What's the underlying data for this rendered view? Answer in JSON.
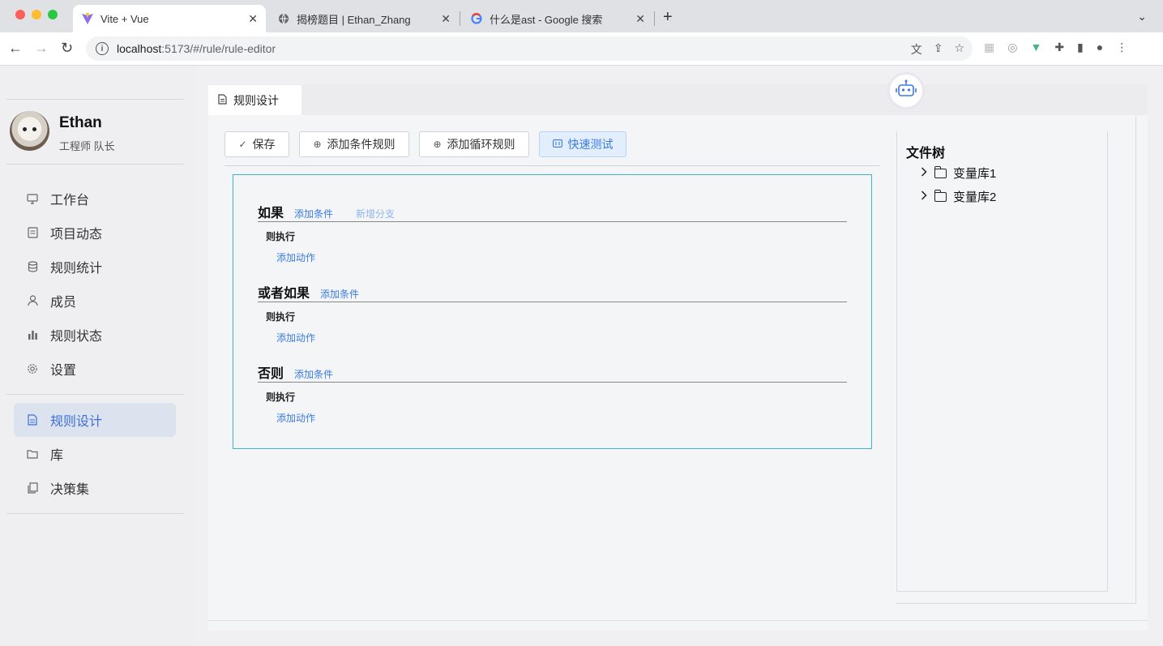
{
  "browser": {
    "tabs": [
      {
        "title": "Vite + Vue",
        "icon": "vite-icon",
        "active": true
      },
      {
        "title": "揭榜题目 | Ethan_Zhang",
        "icon": "globe-icon",
        "active": false
      },
      {
        "title": "什么是ast - Google 搜索",
        "icon": "google-icon",
        "active": false
      }
    ],
    "url_host": "localhost",
    "url_path": ":5173/#/rule/rule-editor"
  },
  "profile": {
    "name": "Ethan",
    "role": "工程师 队长"
  },
  "sidebar": {
    "items": [
      {
        "label": "工作台",
        "icon": "monitor-icon"
      },
      {
        "label": "项目动态",
        "icon": "news-icon"
      },
      {
        "label": "规则统计",
        "icon": "database-icon"
      },
      {
        "label": "成员",
        "icon": "user-icon"
      },
      {
        "label": "规则状态",
        "icon": "bar-chart-icon"
      },
      {
        "label": "设置",
        "icon": "gear-icon"
      }
    ],
    "items2": [
      {
        "label": "规则设计",
        "icon": "document-icon",
        "active": true
      },
      {
        "label": "库",
        "icon": "folder-icon"
      },
      {
        "label": "决策集",
        "icon": "copy-icon"
      }
    ]
  },
  "page_tab": {
    "label": "规则设计"
  },
  "toolbar": {
    "save": "保存",
    "add_condition_rule": "添加条件规则",
    "add_loop_rule": "添加循环规则",
    "quick_test": "快速测试"
  },
  "rule": {
    "if_title": "如果",
    "add_condition": "添加条件",
    "add_branch": "新增分支",
    "then": "则执行",
    "add_action": "添加动作",
    "else_if_title": "或者如果",
    "else_title": "否则"
  },
  "tree": {
    "title": "文件树",
    "items": [
      "变量库1",
      "变量库2"
    ]
  }
}
